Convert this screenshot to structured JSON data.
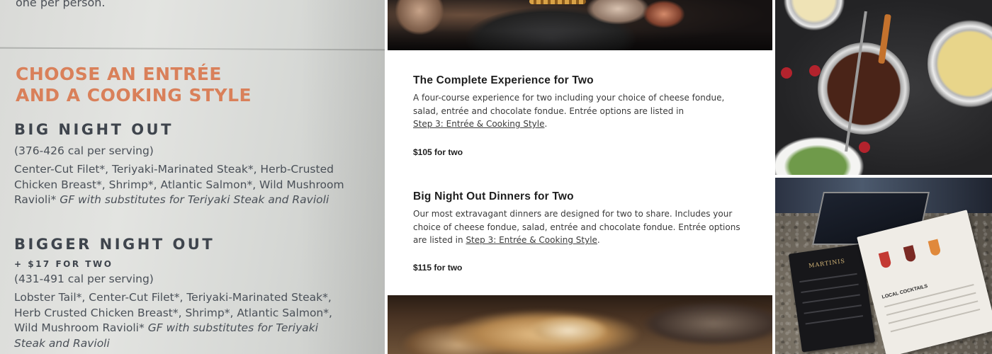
{
  "menu_photo": {
    "top_text": "one per person.",
    "heading_line1": "CHOOSE AN ENTRÉE",
    "heading_line2": "AND A COOKING STYLE",
    "big_night_out": {
      "title": "BIG NIGHT OUT",
      "calories": "(376-426 cal per serving)",
      "items": "Center-Cut Filet*, Teriyaki-Marinated Steak*, Herb-Crusted Chicken Breast*, Shrimp*, Atlantic Salmon*, Wild Mushroom Ravioli*",
      "gf_note": "GF with substitutes for Teriyaki Steak and Ravioli"
    },
    "bigger_night_out": {
      "title": "BIGGER NIGHT OUT",
      "price": "+ $17 FOR TWO",
      "calories": "(431-491 cal per serving)",
      "items": "Lobster Tail*, Center-Cut Filet*, Teriyaki-Marinated Steak*, Herb Crusted Chicken Breast*, Shrimp*, Atlantic Salmon*, Wild Mushroom Ravioli*",
      "gf_note": "GF with substitutes for Teriyaki Steak and Ravioli"
    }
  },
  "web_panel": {
    "offers": [
      {
        "title": "The Complete Experience for Two",
        "description": "A four-course experience for two including your choice of cheese fondue, salad, entrée and chocolate fondue. Entrée options are listed in",
        "link": "Step 3: Entrée & Cooking Style",
        "suffix": ".",
        "price": "$105 for two"
      },
      {
        "title": "Big Night Out Dinners for Two",
        "description": "Our most extravagant dinners are designed for two to share. Includes your choice of cheese fondue, salad, entrée and chocolate fondue. Entrée options are listed in",
        "link": "Step 3: Entrée & Cooking Style",
        "suffix": ".",
        "price": "$115 for two"
      }
    ]
  },
  "bar_photo": {
    "martini_card_title": "MARTINIS",
    "cocktail_card_title": "LOCAL COCKTAILS"
  },
  "colors": {
    "menu_heading": "#d9805a",
    "menu_text": "#4a5058",
    "web_title": "#1d1d1d"
  }
}
